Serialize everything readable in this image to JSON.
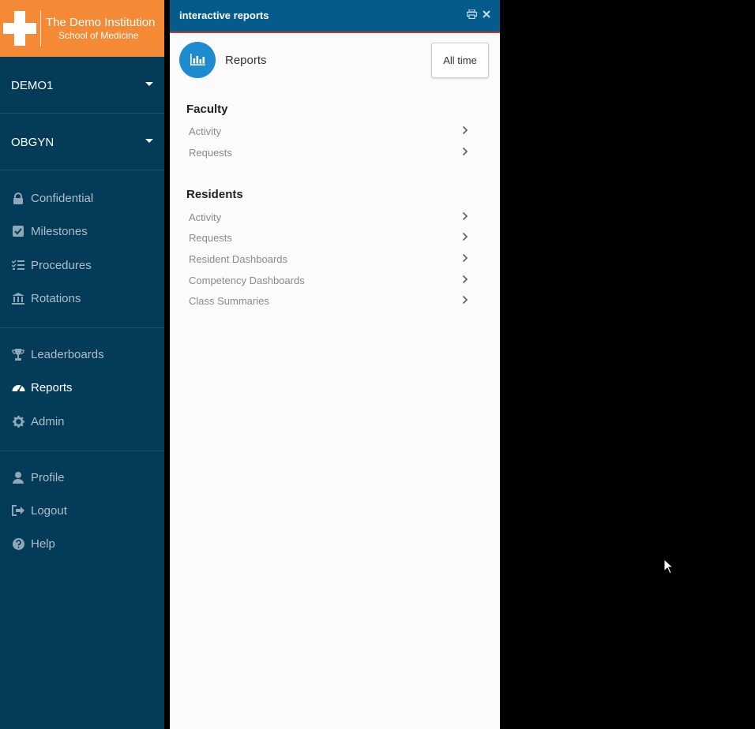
{
  "brand": {
    "name": "The Demo Institution",
    "subtitle": "School of Medicine",
    "color": "#f48a36"
  },
  "sidebar": {
    "pickers": [
      {
        "label": "DEMO1"
      },
      {
        "label": "OBGYN"
      }
    ],
    "groups": [
      [
        {
          "label": "Confidential",
          "icon": "lock-icon"
        },
        {
          "label": "Milestones",
          "icon": "checkbox-icon"
        },
        {
          "label": "Procedures",
          "icon": "tasks-icon"
        },
        {
          "label": "Rotations",
          "icon": "institution-icon"
        }
      ],
      [
        {
          "label": "Leaderboards",
          "icon": "trophy-icon"
        },
        {
          "label": "Reports",
          "icon": "dashboard-icon",
          "active": true
        },
        {
          "label": "Admin",
          "icon": "gear-icon"
        }
      ],
      [
        {
          "label": "Profile",
          "icon": "user-icon"
        },
        {
          "label": "Logout",
          "icon": "logout-icon"
        },
        {
          "label": "Help",
          "icon": "question-icon"
        }
      ]
    ]
  },
  "panel": {
    "title": "interactive reports",
    "heading": "Reports",
    "range_button": "All time",
    "sections": [
      {
        "title": "Faculty",
        "items": [
          "Activity",
          "Requests"
        ]
      },
      {
        "title": "Residents",
        "items": [
          "Activity",
          "Requests",
          "Resident Dashboards",
          "Competency Dashboards",
          "Class Summaries"
        ]
      }
    ]
  }
}
